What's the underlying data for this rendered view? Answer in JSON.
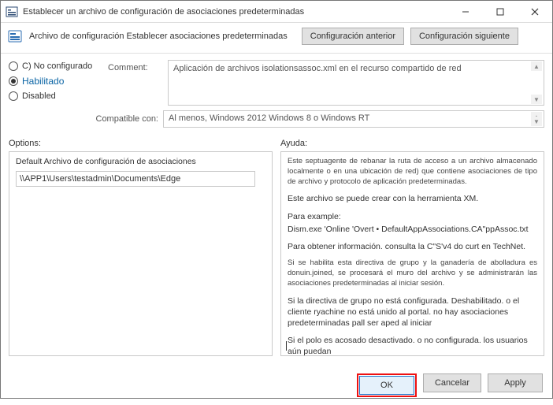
{
  "title": "Establecer un archivo de configuración de asociaciones predeterminadas",
  "header": {
    "label": "Archivo de configuración Establecer asociaciones predeterminadas",
    "prev": "Configuración anterior",
    "next": "Configuración siguiente"
  },
  "state": {
    "notconf": "C) No configurado",
    "enabled": "Habilitado",
    "disabled": "Disabled"
  },
  "comment": {
    "label": "Comment:",
    "value": "Aplicación de archivos isolationsassoc.xml en el recurso compartido de red"
  },
  "compat": {
    "label": "Compatible con:",
    "value": "Al menos, Windows 2012 Windows 8 o Windows RT"
  },
  "options": {
    "head": "Options:",
    "row_label": "Default Archivo de configuración de asociaciones",
    "value": "\\\\APP1\\Users\\testadmin\\Documents\\Edge"
  },
  "help": {
    "head": "Ayuda:",
    "p1": "Este septuagente de rebanar la ruta de acceso a un archivo almacenado localmente o en una ubicación de red) que contiene asociaciones de tipo de archivo y protocolo de aplicación predeterminadas.",
    "p2": "Este archivo se puede crear con la herramienta XM.",
    "p3a": "Para example:",
    "p3b": "Dism.exe 'Online 'Overt • DefaultAppAssociations.CA\"ppAssoc.txt",
    "p4": "Para obtener información. consulta la C\"S'v4 do curt en TechNet.",
    "p5": "Si se habilita esta directiva de grupo y la ganadería de abolladura es donuin.joined, se procesará el muro del archivo y se administrarán las asociaciones predeterminadas al iniciar sesión.",
    "p6": "Si la directiva de grupo no está configurada. Deshabilitado. o el cliente ryachine no está unido al portal. no hay asociaciones predeterminadas pall ser aped al iniciar",
    "p7": "Si el polo es acosado desactivado. o no configurada. los usuarios aún puedan"
  },
  "buttons": {
    "ok": "OK",
    "cancel": "Cancelar",
    "apply": "Apply"
  },
  "win": {
    "min": "Minimize",
    "max": "Maximize",
    "close": "Close"
  }
}
